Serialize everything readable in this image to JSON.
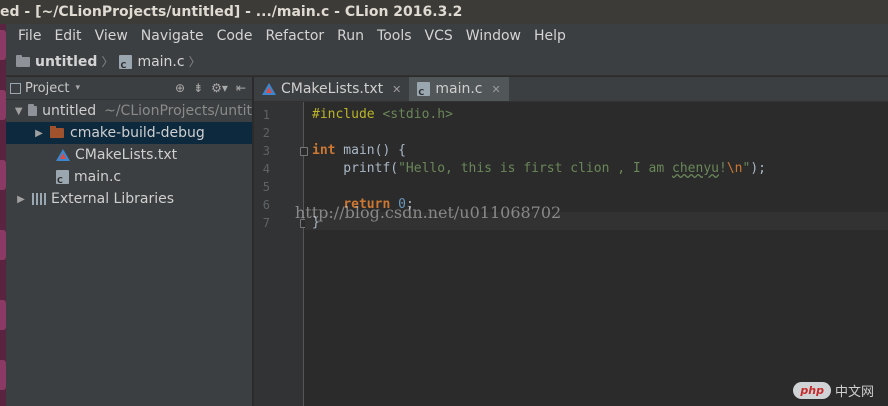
{
  "window": {
    "title": "ed - [~/CLionProjects/untitled] - .../main.c - CLion 2016.3.2"
  },
  "menu": [
    "File",
    "Edit",
    "View",
    "Navigate",
    "Code",
    "Refactor",
    "Run",
    "Tools",
    "VCS",
    "Window",
    "Help"
  ],
  "navbar": {
    "project": "untitled",
    "file": "main.c"
  },
  "project_panel": {
    "title": "Project",
    "tree": {
      "root": {
        "name": "untitled",
        "path": "~/CLionProjects/untit"
      },
      "build_dir": "cmake-build-debug",
      "cmake_file": "CMakeLists.txt",
      "source_file": "main.c",
      "external": "External Libraries"
    }
  },
  "tabs": [
    {
      "label": "CMakeLists.txt",
      "active": false
    },
    {
      "label": "main.c",
      "active": true
    }
  ],
  "editor": {
    "line_numbers": [
      "1",
      "2",
      "3",
      "4",
      "5",
      "6",
      "7"
    ],
    "code": {
      "l1_directive": "#include",
      "l1_header": "<stdio.h>",
      "l3_kw": "int",
      "l3_rest": " main() {",
      "l4_fn": "    printf(",
      "l4_str1": "\"Hello, this is first clion , I am ",
      "l4_name": "chenyu",
      "l4_str2": "!",
      "l4_esc": "\\n",
      "l4_str3": "\"",
      "l4_end": ");",
      "l6_kw": "return",
      "l6_num": "0",
      "l6_end": ";",
      "l7": "}"
    }
  },
  "watermark": "http://blog.csdn.net/u011068702",
  "logo": {
    "badge": "php",
    "text": "中文网"
  },
  "colors": {
    "keyword": "#cc7832",
    "string": "#6a8759",
    "number": "#6897bb",
    "preprocessor": "#bbb529",
    "selection": "#0d293e"
  }
}
